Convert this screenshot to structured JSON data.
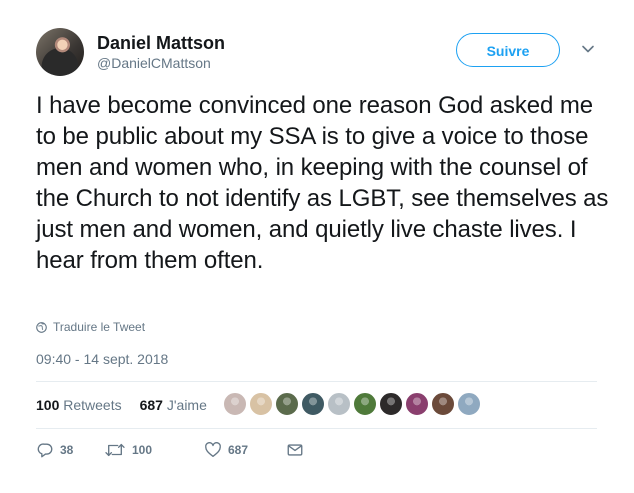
{
  "author": {
    "name": "Daniel Mattson",
    "handle": "@DanielCMattson"
  },
  "follow_button": "Suivre",
  "tweet_text": "I have become convinced one reason God asked me to be public about my SSA is to give a voice to those men and women who, in keeping with the counsel of the Church to not identify as LGBT, see themselves as just men and women, and quietly live chaste lives. I hear from them often.",
  "translate_label": "Traduire le Tweet",
  "timestamp": "09:40 - 14 sept. 2018",
  "stats": {
    "retweets_count": "100",
    "retweets_label": "Retweets",
    "likes_count": "687",
    "likes_label": "J'aime"
  },
  "liker_colors": [
    "#c9b8b4",
    "#d8c2a4",
    "#5b6b4c",
    "#3f5a63",
    "#b8c0c6",
    "#4f7a3a",
    "#2d2a2a",
    "#8a3f6e",
    "#6b4a3a",
    "#8fa9c0"
  ],
  "actions": {
    "reply_count": "38",
    "retweet_count": "100",
    "like_count": "687"
  },
  "colors": {
    "accent": "#1da1f2",
    "text": "#14171a",
    "secondary": "#657786"
  }
}
